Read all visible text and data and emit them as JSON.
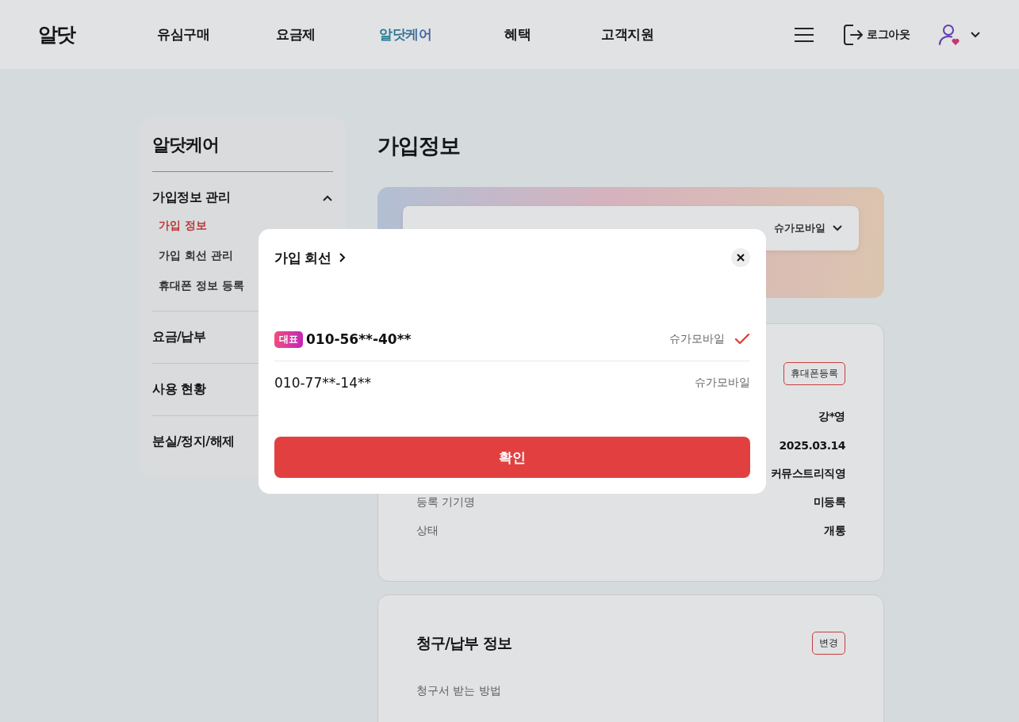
{
  "header": {
    "logo": "알닷",
    "nav": [
      {
        "label": "유심구매",
        "selected": false
      },
      {
        "label": "요금제",
        "selected": false
      },
      {
        "label": "알닷케어",
        "selected": true
      },
      {
        "label": "혜택",
        "selected": false
      },
      {
        "label": "고객지원",
        "selected": false
      }
    ],
    "logout": "로그아웃"
  },
  "sidebar": {
    "title": "알닷케어",
    "groups": [
      {
        "label": "가입정보 관리",
        "expanded": true,
        "children": [
          {
            "label": "가입 정보",
            "selected": true
          },
          {
            "label": "가입 회선 관리",
            "selected": false
          },
          {
            "label": "휴대폰 정보 등록",
            "selected": false
          }
        ]
      },
      {
        "label": "요금/납부",
        "expanded": false
      },
      {
        "label": "사용 현황",
        "expanded": false
      },
      {
        "label": "분실/정지/해제",
        "expanded": false
      }
    ]
  },
  "page_title": "가입정보",
  "line_card": {
    "carrier": "슈가모바일"
  },
  "info_card": {
    "button": "휴대폰등록",
    "rows": [
      {
        "value": "강*영"
      },
      {
        "value": "2025.03.14"
      },
      {
        "value": "커뮤스트리직영"
      },
      {
        "label": "등록 기기명",
        "value": "미등록"
      },
      {
        "label": "상태",
        "value": "개통"
      }
    ]
  },
  "billing_card": {
    "title": "청구/납부 정보",
    "button": "변경",
    "rows": [
      {
        "label": "청구서 받는 방법"
      }
    ]
  },
  "modal": {
    "title": "가입 회선",
    "lines": [
      {
        "badge": "대표",
        "number": "010-56**-40**",
        "carrier": "슈가모바일",
        "selected": true
      },
      {
        "number": "010-77**-14**",
        "carrier": "슈가모바일",
        "selected": false
      }
    ],
    "confirm": "확인"
  }
}
